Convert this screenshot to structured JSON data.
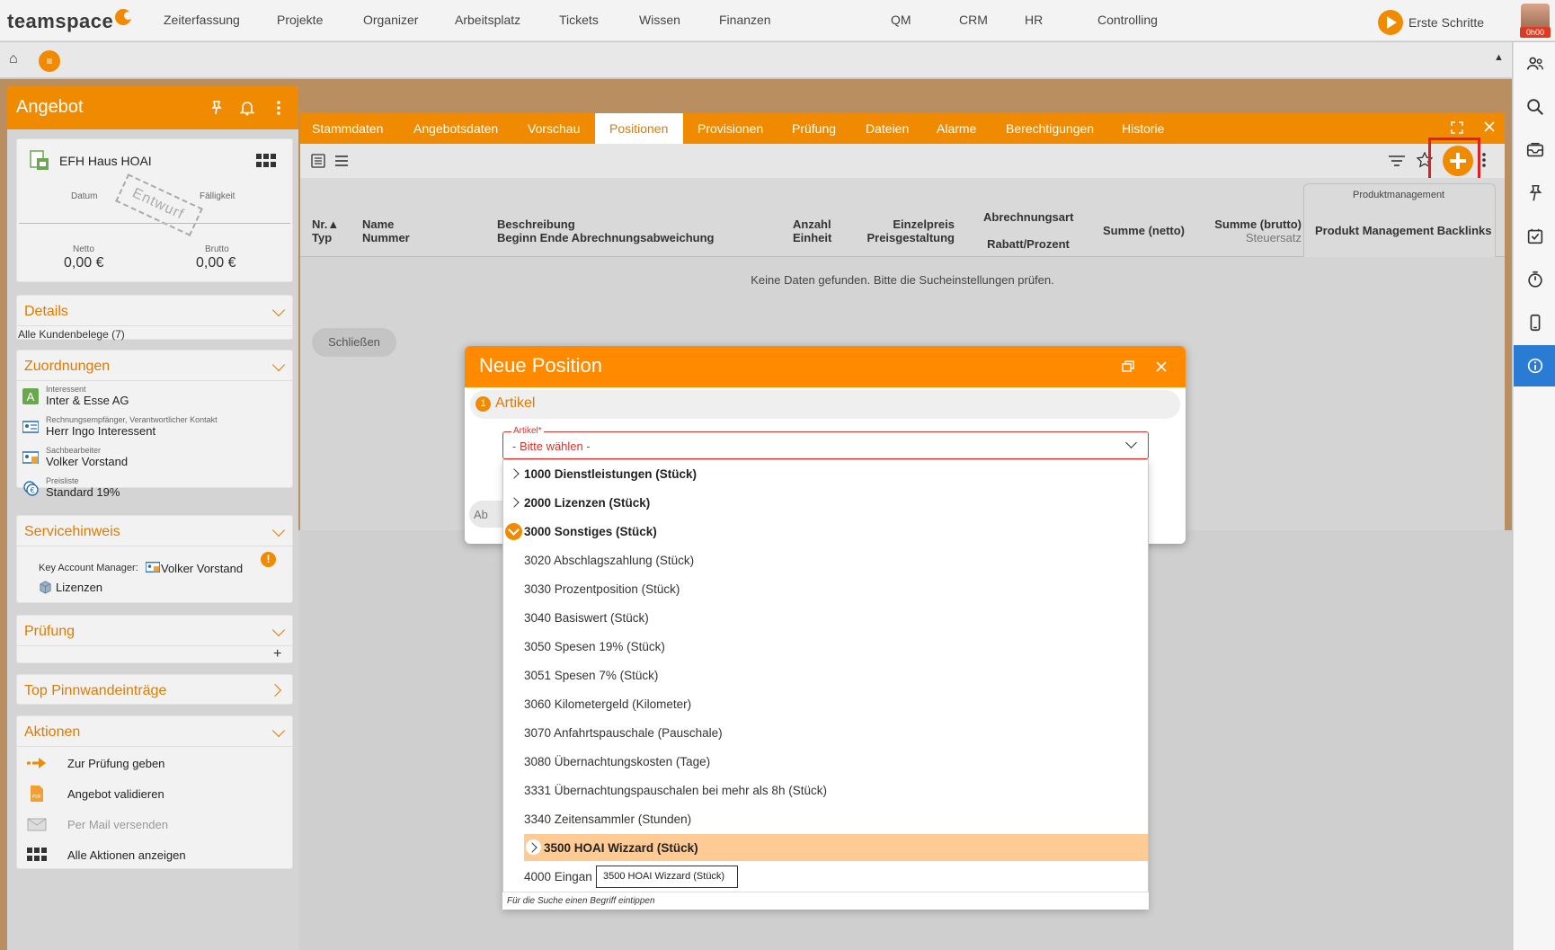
{
  "app": {
    "logo": "teamspace",
    "nav": [
      "Zeiterfassung",
      "Projekte",
      "Organizer",
      "Arbeitsplatz",
      "Tickets",
      "Wissen",
      "Finanzen",
      "QM",
      "CRM",
      "HR",
      "Controlling"
    ],
    "erste_schritte": "Erste Schritte",
    "timer_badge": "0h00",
    "menu_glyph": "≡",
    "home_glyph": "⌂",
    "collapse_glyph": "▲"
  },
  "left_panel": {
    "title": "Angebot",
    "summary": {
      "name": "EFH Haus HOAI",
      "datum_label": "Datum",
      "faelligkeit_label": "Fälligkeit",
      "stamp": "Entwurf",
      "netto_label": "Netto",
      "netto_value": "0,00 €",
      "brutto_label": "Brutto",
      "brutto_value": "0,00 €"
    },
    "details": {
      "title": "Details",
      "link": "Alle Kundenbelege (7)"
    },
    "zuordnungen": {
      "title": "Zuordnungen",
      "items": [
        {
          "small": "Interessent",
          "main": "Inter & Esse AG",
          "icon": "letter-a-icon"
        },
        {
          "small": "Rechnungsempfänger, Verantwortlicher Kontakt",
          "main": "Herr Ingo Interessent",
          "icon": "contact-card-icon"
        },
        {
          "small": "Sachbearbeiter",
          "main": "Volker Vorstand",
          "icon": "user-card-icon"
        },
        {
          "small": "Preisliste",
          "main": "Standard 19%",
          "icon": "euro-icon"
        }
      ]
    },
    "servicehinweis": {
      "title": "Servicehinweis",
      "kam_label": "Key Account Manager:",
      "kam_name": "Volker Vorstand",
      "lizenzen": "Lizenzen"
    },
    "pruefung": {
      "title": "Prüfung",
      "add": "+"
    },
    "pinnwand": {
      "title": "Top Pinnwandeinträge"
    },
    "aktionen": {
      "title": "Aktionen",
      "items": [
        "Zur Prüfung geben",
        "Angebot validieren",
        "Per Mail versenden",
        "Alle Aktionen anzeigen"
      ]
    }
  },
  "main": {
    "tabs": [
      "Stammdaten",
      "Angebotsdaten",
      "Vorschau",
      "Positionen",
      "Provisionen",
      "Prüfung",
      "Dateien",
      "Alarme",
      "Berechtigungen",
      "Historie"
    ],
    "active_tab": "Positionen",
    "columns": {
      "nr": "Nr.▲",
      "typ": "Typ",
      "name": "Name",
      "nummer": "Nummer",
      "beschreibung": "Beschreibung",
      "beginn": "Beginn Ende Abrechnungsabweichung",
      "anzahl": "Anzahl",
      "einheit": "Einheit",
      "einzelpreis": "Einzelpreis",
      "preisgestaltung": "Preisgestaltung",
      "abrechnungsart": "Abrechnungsart",
      "rabatt": "Rabatt/Prozent",
      "summe_netto": "Summe (netto)",
      "summe_brutto": "Summe (brutto)",
      "steuersatz": "Steuersatz",
      "produktmanagement": "Produktmanagement",
      "backlinks": "Produkt Management Backlinks"
    },
    "no_data": "Keine Daten gefunden. Bitte die Sucheinstellungen prüfen.",
    "close_button": "Schließen"
  },
  "dialog": {
    "title": "Neue Position",
    "step_number": "1",
    "step_label": "Artikel",
    "field_label": "Artikel*",
    "field_value": "- Bitte wählen -",
    "ab_button": "Ab",
    "options": [
      {
        "label": "1000 Dienstleistungen (Stück)",
        "group": true,
        "state": "collapsed"
      },
      {
        "label": "2000 Lizenzen (Stück)",
        "group": true,
        "state": "collapsed"
      },
      {
        "label": "3000 Sonstiges (Stück)",
        "group": true,
        "state": "expanded"
      },
      {
        "label": "3020 Abschlagszahlung (Stück)",
        "group": false
      },
      {
        "label": "3030 Prozentposition (Stück)",
        "group": false
      },
      {
        "label": "3040 Basiswert (Stück)",
        "group": false
      },
      {
        "label": "3050 Spesen 19% (Stück)",
        "group": false
      },
      {
        "label": "3051 Spesen 7% (Stück)",
        "group": false
      },
      {
        "label": "3060 Kilometergeld (Kilometer)",
        "group": false
      },
      {
        "label": "3070 Anfahrtspauschale (Pauschale)",
        "group": false
      },
      {
        "label": "3080 Übernachtungskosten (Tage)",
        "group": false
      },
      {
        "label": "3331 Übernachtungspauschalen bei mehr als 8h (Stück)",
        "group": false
      },
      {
        "label": "3340 Zeitensammler (Stunden)",
        "group": false
      },
      {
        "label": "3500 HOAI Wizzard (Stück)",
        "group": true,
        "state": "collapsed",
        "highlighted": true
      },
      {
        "label": "4000 Eingan",
        "group": false
      }
    ],
    "tooltip": "3500 HOAI Wizzard (Stück)",
    "search_hint": "Für die Suche einen Begriff eintippen"
  },
  "colors": {
    "accent": "#f08a00",
    "highlight": "#ffcb94",
    "error": "#d8322b",
    "info": "#2a7bd4"
  }
}
